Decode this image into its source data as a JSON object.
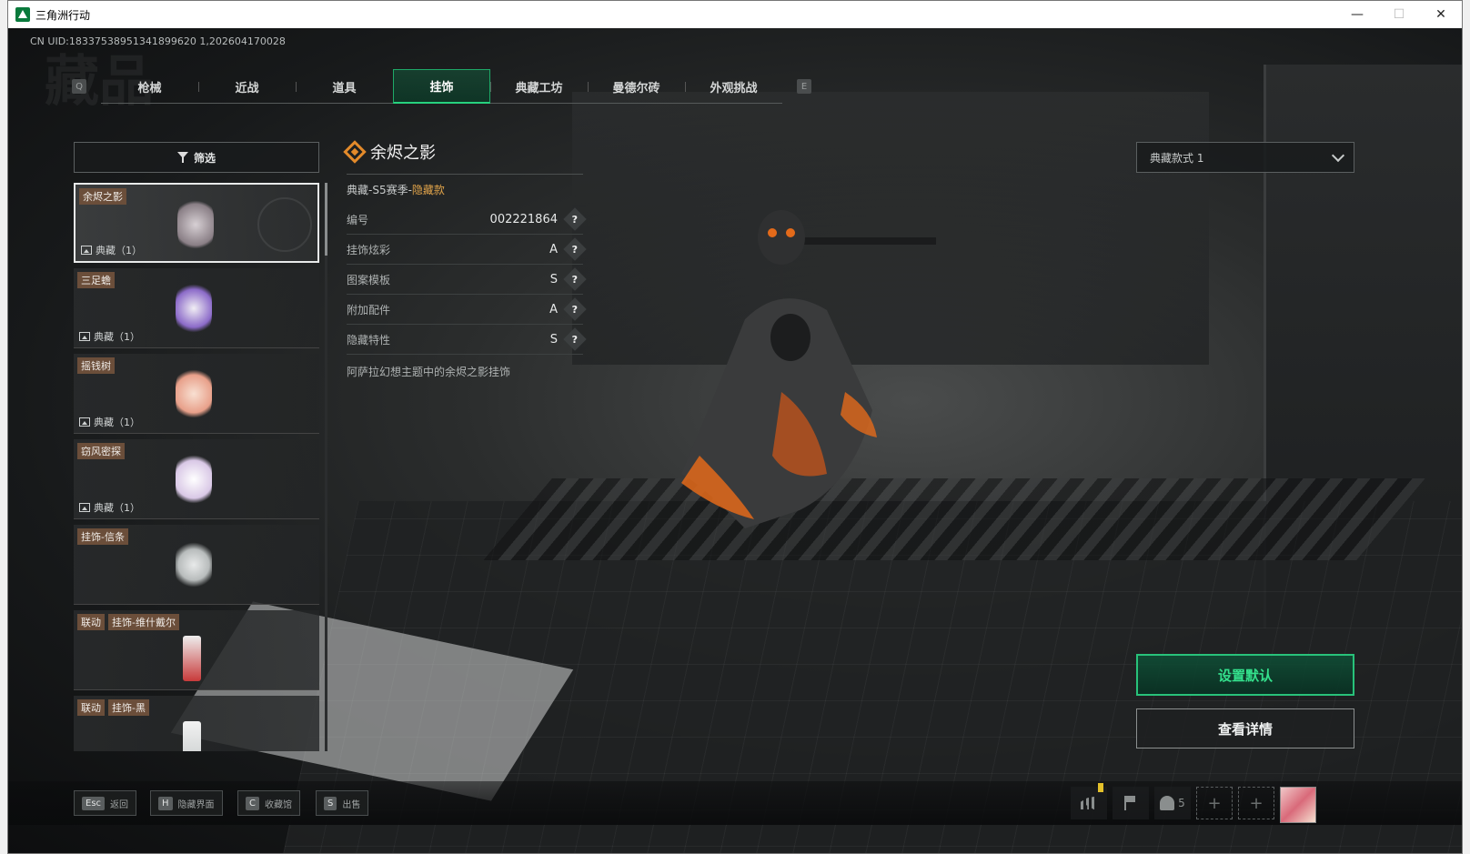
{
  "window": {
    "title": "三角洲行动",
    "minimize": "—",
    "maximize": "☐",
    "close": "✕"
  },
  "game": {
    "uid_text": "CN UID:18337538951341899620 1,202604170028",
    "watermark": "藏品",
    "tabs": {
      "left_key": "Q",
      "right_key": "E",
      "items": [
        {
          "label": "枪械",
          "active": false
        },
        {
          "label": "近战",
          "active": false
        },
        {
          "label": "道具",
          "active": false
        },
        {
          "label": "挂饰",
          "active": true
        },
        {
          "label": "典藏工坊",
          "active": false
        },
        {
          "label": "曼德尔砖",
          "active": false
        },
        {
          "label": "外观挑战",
          "active": false
        }
      ]
    },
    "filter_label": "筛选",
    "list": [
      {
        "tags": [
          "余烬之影"
        ],
        "sub": "典藏（1）",
        "selected": true,
        "thumb_color": "#8a7f86"
      },
      {
        "tags": [
          "三足蟾"
        ],
        "sub": "典藏（1）",
        "selected": false,
        "thumb_color": "#8c6bc9"
      },
      {
        "tags": [
          "摇钱树"
        ],
        "sub": "典藏（1）",
        "selected": false,
        "thumb_color": "#e8a08a"
      },
      {
        "tags": [
          "窃风密探"
        ],
        "sub": "典藏（1）",
        "selected": false,
        "thumb_color": "#d9c8e6"
      },
      {
        "tags": [
          "挂饰-信条"
        ],
        "sub": "",
        "selected": false,
        "thumb_color": "#b8bcbc"
      },
      {
        "tags": [
          "联动",
          "挂饰-维什戴尔"
        ],
        "sub": "",
        "selected": false,
        "thumb_color": "#c83a3a"
      },
      {
        "tags": [
          "联动",
          "挂饰-黑"
        ],
        "sub": "",
        "selected": false,
        "thumb_color": "#c8cccc"
      }
    ],
    "detail": {
      "title": "余烬之影",
      "series_prefix": "典藏-S5赛季-",
      "series_highlight": "隐藏款",
      "rows": [
        {
          "label": "编号",
          "value": "002221864"
        },
        {
          "label": "挂饰炫彩",
          "value": "A"
        },
        {
          "label": "图案模板",
          "value": "S"
        },
        {
          "label": "附加配件",
          "value": "A"
        },
        {
          "label": "隐藏特性",
          "value": "S"
        }
      ],
      "help_glyph": "?",
      "description": "阿萨拉幻想主题中的余烬之影挂饰"
    },
    "style_select": "典藏款式 1",
    "buttons": {
      "set_default": "设置默认",
      "view_details": "查看详情"
    },
    "bottom_hints": [
      {
        "key": "Esc",
        "label": "返回"
      },
      {
        "key": "H",
        "label": "隐藏界面"
      },
      {
        "key": "C",
        "label": "收藏馆"
      },
      {
        "key": "S",
        "label": "出售"
      }
    ],
    "party_count": "5",
    "plus": "+"
  },
  "colors": {
    "accent_green": "#28c27a",
    "tag_brown": "#6b4e3a",
    "ember_orange": "#e36a1a",
    "highlight_gold": "#e0a34a"
  }
}
